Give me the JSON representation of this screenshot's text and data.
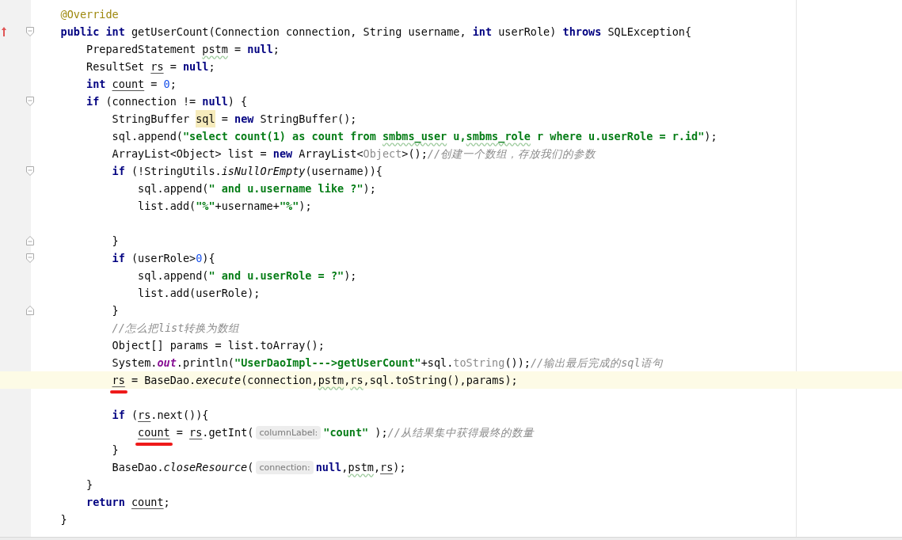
{
  "editor": {
    "lines": [
      {
        "current": false,
        "tokens": [
          {
            "t": "    @Override",
            "kind": "ann"
          }
        ]
      },
      {
        "current": false,
        "fold_start": true,
        "override": true,
        "tokens": [
          {
            "t": "    public int ",
            "kind": "kw"
          },
          {
            "t": "getUserCount(Connection connection, String username, ",
            "kind": "plain"
          },
          {
            "t": "int ",
            "kind": "kw"
          },
          {
            "t": "userRole) ",
            "kind": "plain"
          },
          {
            "t": "throws ",
            "kind": "kw"
          },
          {
            "t": "SQLException{",
            "kind": "plain"
          }
        ]
      },
      {
        "current": false,
        "tokens": [
          {
            "t": "        PreparedStatement ",
            "kind": "plain"
          },
          {
            "t": "pstm",
            "kind": "plain",
            "wavy": true
          },
          {
            "t": " = ",
            "kind": "plain"
          },
          {
            "t": "null",
            "kind": "kw"
          },
          {
            "t": ";",
            "kind": "plain"
          }
        ]
      },
      {
        "current": false,
        "tokens": [
          {
            "t": "        ResultSet ",
            "kind": "plain"
          },
          {
            "t": "rs",
            "kind": "plain",
            "underline": true
          },
          {
            "t": " = ",
            "kind": "plain"
          },
          {
            "t": "null",
            "kind": "kw"
          },
          {
            "t": ";",
            "kind": "plain"
          }
        ]
      },
      {
        "current": false,
        "tokens": [
          {
            "t": "        int ",
            "kind": "kw"
          },
          {
            "t": "count",
            "kind": "plain",
            "underline": true
          },
          {
            "t": " = ",
            "kind": "plain"
          },
          {
            "t": "0",
            "kind": "num"
          },
          {
            "t": ";",
            "kind": "plain"
          }
        ]
      },
      {
        "current": false,
        "fold_start": true,
        "tokens": [
          {
            "t": "        if ",
            "kind": "kw"
          },
          {
            "t": "(connection != ",
            "kind": "plain"
          },
          {
            "t": "null",
            "kind": "kw"
          },
          {
            "t": ") {",
            "kind": "plain"
          }
        ]
      },
      {
        "current": false,
        "tokens": [
          {
            "t": "            StringBuffer ",
            "kind": "plain"
          },
          {
            "t": "sql",
            "kind": "plain",
            "highlight": true
          },
          {
            "t": " = ",
            "kind": "plain"
          },
          {
            "t": "new ",
            "kind": "kw"
          },
          {
            "t": "StringBuffer();",
            "kind": "plain"
          }
        ]
      },
      {
        "current": false,
        "tokens": [
          {
            "t": "            sql.append(",
            "kind": "plain"
          },
          {
            "t": "\"select count(1) as count from ",
            "kind": "str"
          },
          {
            "t": "smbms_user",
            "kind": "str",
            "wavy": true
          },
          {
            "t": " u,",
            "kind": "str"
          },
          {
            "t": "smbms_role",
            "kind": "str",
            "wavy": true
          },
          {
            "t": " r where u.userRole = r.id\"",
            "kind": "str"
          },
          {
            "t": ");",
            "kind": "plain"
          }
        ]
      },
      {
        "current": false,
        "tokens": [
          {
            "t": "            ArrayList<Object> list = ",
            "kind": "plain"
          },
          {
            "t": "new ",
            "kind": "kw"
          },
          {
            "t": "ArrayList<",
            "kind": "plain"
          },
          {
            "t": "Object",
            "kind": "dim"
          },
          {
            "t": ">();",
            "kind": "plain"
          },
          {
            "t": "//创建一个数组，存放我们的参数",
            "kind": "com"
          }
        ]
      },
      {
        "current": false,
        "fold_start": true,
        "tokens": [
          {
            "t": "            if ",
            "kind": "kw"
          },
          {
            "t": "(!StringUtils.",
            "kind": "plain"
          },
          {
            "t": "isNullOrEmpty",
            "kind": "ital"
          },
          {
            "t": "(username)){",
            "kind": "plain"
          }
        ]
      },
      {
        "current": false,
        "tokens": [
          {
            "t": "                sql.append(",
            "kind": "plain"
          },
          {
            "t": "\" and u.username like ?\"",
            "kind": "str"
          },
          {
            "t": ");",
            "kind": "plain"
          }
        ]
      },
      {
        "current": false,
        "tokens": [
          {
            "t": "                list.add(",
            "kind": "plain"
          },
          {
            "t": "\"%\"",
            "kind": "str"
          },
          {
            "t": "+username+",
            "kind": "plain"
          },
          {
            "t": "\"%\"",
            "kind": "str"
          },
          {
            "t": ");",
            "kind": "plain"
          }
        ]
      },
      {
        "current": false
      },
      {
        "current": false,
        "fold_end": true,
        "tokens": [
          {
            "t": "            }",
            "kind": "plain"
          }
        ]
      },
      {
        "current": false,
        "fold_start": true,
        "tokens": [
          {
            "t": "            if ",
            "kind": "kw"
          },
          {
            "t": "(userRole>",
            "kind": "plain"
          },
          {
            "t": "0",
            "kind": "num"
          },
          {
            "t": "){",
            "kind": "plain"
          }
        ]
      },
      {
        "current": false,
        "tokens": [
          {
            "t": "                sql.append(",
            "kind": "plain"
          },
          {
            "t": "\" and u.userRole = ?\"",
            "kind": "str"
          },
          {
            "t": ");",
            "kind": "plain"
          }
        ]
      },
      {
        "current": false,
        "tokens": [
          {
            "t": "                list.add(userRole);",
            "kind": "plain"
          }
        ]
      },
      {
        "current": false,
        "fold_end": true,
        "tokens": [
          {
            "t": "            }",
            "kind": "plain"
          }
        ]
      },
      {
        "current": false,
        "tokens": [
          {
            "t": "            //怎么把list转换为数组",
            "kind": "com"
          }
        ]
      },
      {
        "current": false,
        "tokens": [
          {
            "t": "            Object[] params = list.toArray();",
            "kind": "plain"
          }
        ]
      },
      {
        "current": false,
        "tokens": [
          {
            "t": "            System.",
            "kind": "plain"
          },
          {
            "t": "out",
            "kind": "static"
          },
          {
            "t": ".println(",
            "kind": "plain"
          },
          {
            "t": "\"UserDaoImpl--->getUserCount\"",
            "kind": "str"
          },
          {
            "t": "+sql.",
            "kind": "plain"
          },
          {
            "t": "toString",
            "kind": "dim"
          },
          {
            "t": "());",
            "kind": "plain"
          },
          {
            "t": "//输出最后完成的sql语句",
            "kind": "com"
          }
        ]
      },
      {
        "current": true,
        "tokens": [
          {
            "t": "            rs",
            "kind": "plain",
            "underline": true,
            "marked": true
          },
          {
            "t": " = BaseDao.",
            "kind": "plain"
          },
          {
            "t": "execute",
            "kind": "ital"
          },
          {
            "t": "(connection,",
            "kind": "plain"
          },
          {
            "t": "pstm",
            "kind": "plain",
            "wavy": true
          },
          {
            "t": ",",
            "kind": "plain"
          },
          {
            "t": "rs",
            "kind": "plain",
            "wavy": true
          },
          {
            "t": ",sql.toString(),params);",
            "kind": "plain"
          }
        ]
      },
      {
        "current": false
      },
      {
        "current": false,
        "tokens": [
          {
            "t": "            if ",
            "kind": "kw"
          },
          {
            "t": "(",
            "kind": "plain"
          },
          {
            "t": "rs",
            "kind": "plain",
            "underline": true
          },
          {
            "t": ".next()){",
            "kind": "plain"
          }
        ]
      },
      {
        "current": false,
        "tokens": [
          {
            "t": "                count",
            "kind": "plain",
            "underline": true,
            "marked": true
          },
          {
            "t": " = ",
            "kind": "plain"
          },
          {
            "t": "rs",
            "kind": "plain",
            "underline": true
          },
          {
            "t": ".getInt(",
            "kind": "plain"
          },
          {
            "t": "columnLabel:",
            "kind": "hint"
          },
          {
            "t": "\"count\"",
            "kind": "str"
          },
          {
            "t": " );",
            "kind": "plain"
          },
          {
            "t": "//从结果集中获得最终的数量",
            "kind": "com"
          }
        ]
      },
      {
        "current": false,
        "tokens": [
          {
            "t": "            }",
            "kind": "plain"
          }
        ]
      },
      {
        "current": false,
        "tokens": [
          {
            "t": "            BaseDao.",
            "kind": "plain"
          },
          {
            "t": "closeResource",
            "kind": "ital"
          },
          {
            "t": "(",
            "kind": "plain"
          },
          {
            "t": "connection:",
            "kind": "hint"
          },
          {
            "t": "null",
            "kind": "kw"
          },
          {
            "t": ",",
            "kind": "plain"
          },
          {
            "t": "pstm",
            "kind": "plain",
            "wavy": true
          },
          {
            "t": ",",
            "kind": "plain"
          },
          {
            "t": "rs",
            "kind": "plain",
            "underline": true
          },
          {
            "t": ");",
            "kind": "plain"
          }
        ]
      },
      {
        "current": false,
        "tokens": [
          {
            "t": "        }",
            "kind": "plain"
          }
        ]
      },
      {
        "current": false,
        "tokens": [
          {
            "t": "        return ",
            "kind": "kw"
          },
          {
            "t": "count",
            "kind": "plain",
            "underline": true
          },
          {
            "t": ";",
            "kind": "plain"
          }
        ]
      },
      {
        "current": false,
        "tokens": [
          {
            "t": "    }",
            "kind": "plain"
          }
        ]
      }
    ]
  }
}
